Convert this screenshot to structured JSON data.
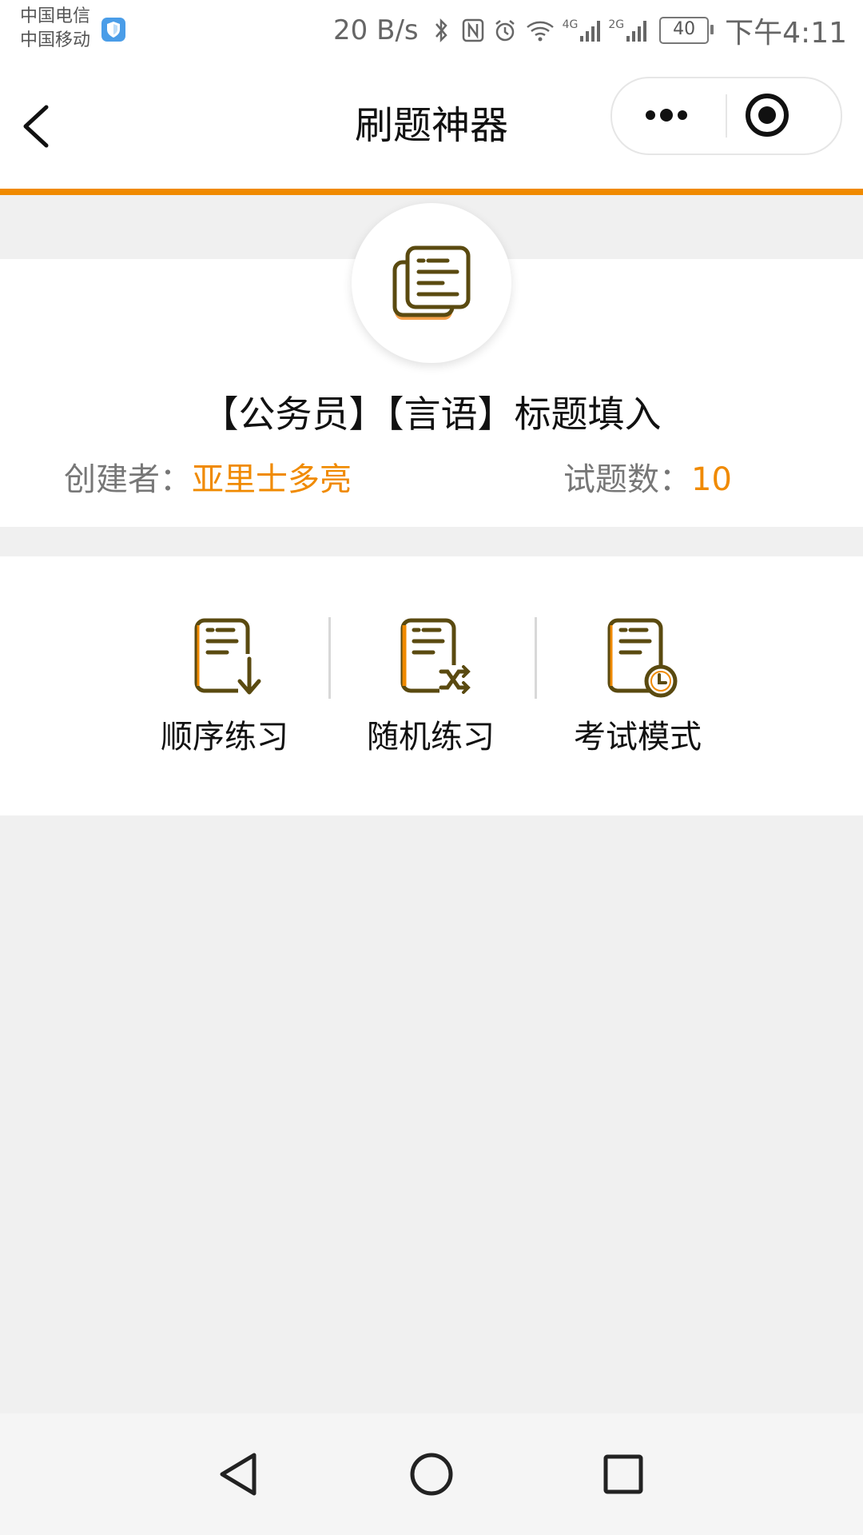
{
  "status_bar": {
    "carrier_1": "中国电信",
    "carrier_2": "中国移动",
    "speed": "20 B/s",
    "net_4g": "4G",
    "net_2g": "2G",
    "battery": "40",
    "time": "下午4:11"
  },
  "nav": {
    "title": "刷题神器"
  },
  "bank": {
    "title": "【公务员】【言语】标题填入",
    "creator_label": "创建者：",
    "creator_name": "亚里士多亮",
    "count_label": "试题数：",
    "count_value": "10"
  },
  "modes": [
    {
      "label": "顺序练习",
      "icon": "sequential-practice-icon"
    },
    {
      "label": "随机练习",
      "icon": "random-practice-icon"
    },
    {
      "label": "考试模式",
      "icon": "exam-mode-icon"
    }
  ],
  "colors": {
    "accent": "#f08a00",
    "icon_dark": "#5a4a10",
    "background": "#f0f0f0"
  }
}
